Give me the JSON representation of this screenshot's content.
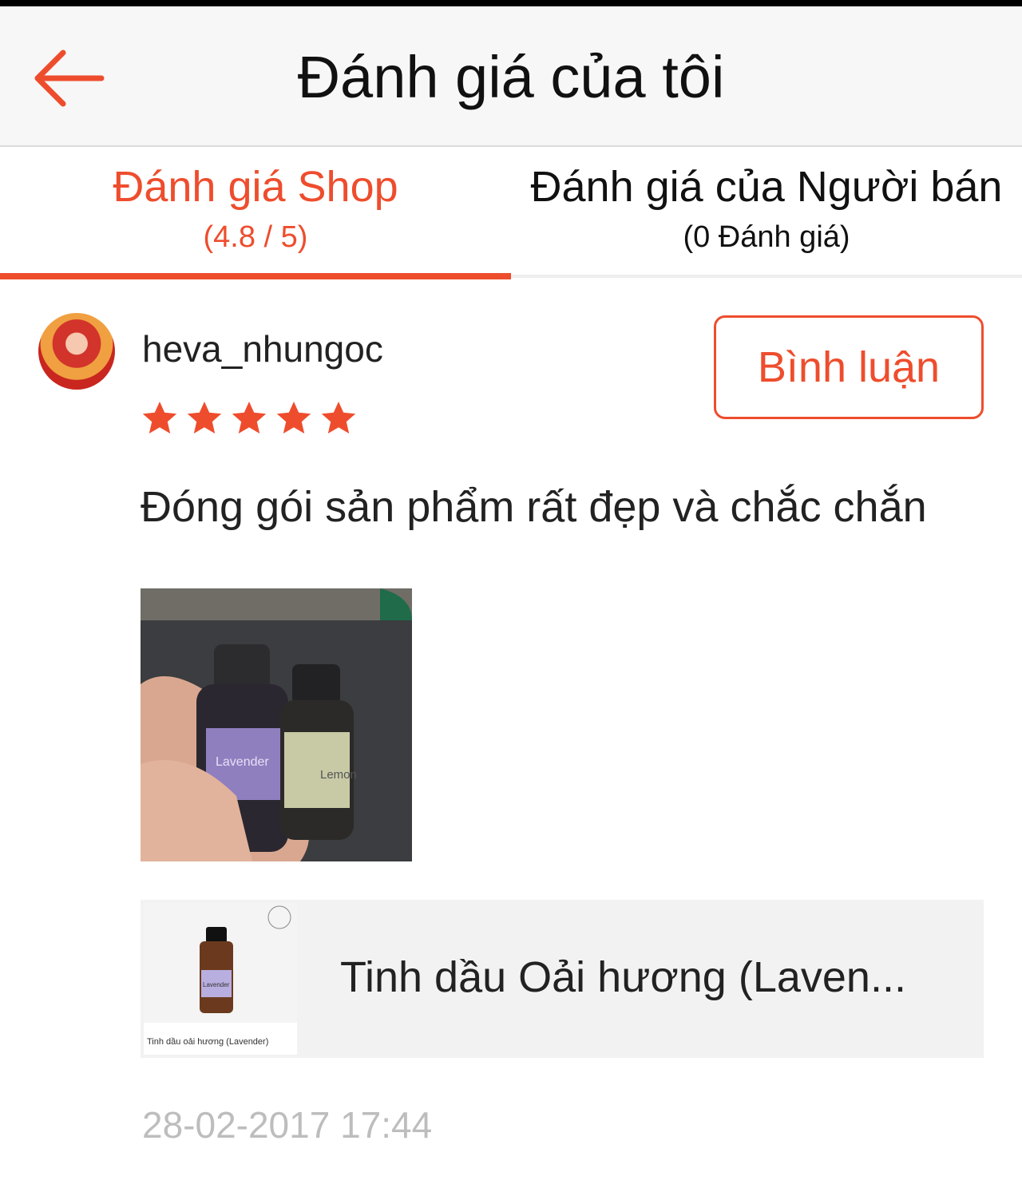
{
  "header": {
    "title": "Đánh giá của tôi",
    "back_icon": "arrow-left-icon",
    "accent": "#ee4d2d"
  },
  "tabs": [
    {
      "label": "Đánh giá Shop",
      "sub": "(4.8 / 5)",
      "active": true
    },
    {
      "label": "Đánh giá của Người bán",
      "sub": "(0 Đánh giá)",
      "active": false
    }
  ],
  "review": {
    "username": "heva_nhungoc",
    "rating": 5,
    "rating_max": 5,
    "comment_button": "Bình luận",
    "text": "Đóng gói sản phẩm rất đẹp và chắc chắn",
    "photo_labels": [
      "Lavender",
      "Lemon"
    ],
    "product": {
      "name": "Tinh dầu Oải hương (Laven...",
      "thumb_caption": "Tinh dầu oải hương (Lavender)",
      "thumb_label": "Lavender"
    },
    "timestamp": "28-02-2017 17:44"
  }
}
